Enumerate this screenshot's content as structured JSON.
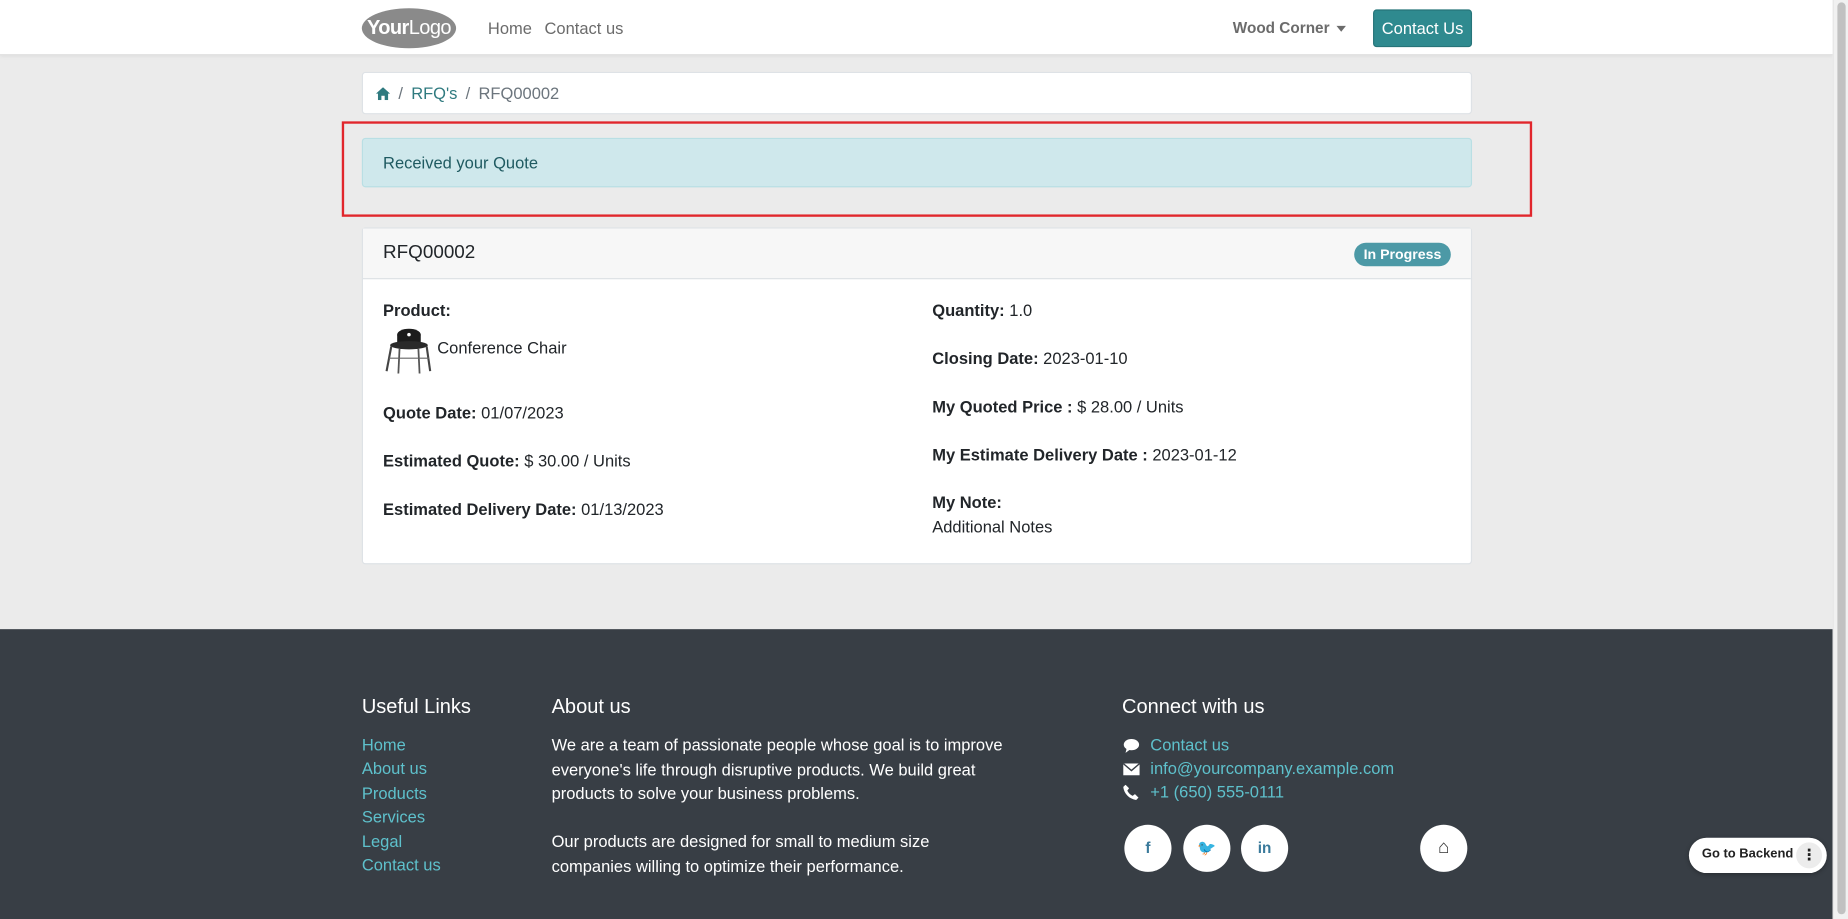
{
  "header": {
    "logo_bold": "Your",
    "logo_thin": "Logo",
    "nav": [
      "Home",
      "Contact us"
    ],
    "user_menu": "Wood Corner",
    "contact_button": "Contact Us"
  },
  "breadcrumb": {
    "home_icon": "home-icon",
    "items": [
      "RFQ's",
      "RFQ00002"
    ],
    "separator": "/"
  },
  "alert": {
    "text": "Received your Quote"
  },
  "rfq": {
    "title": "RFQ00002",
    "status": "In Progress",
    "product_label": "Product:",
    "product_name": "Conference Chair",
    "product_icon": "chair-icon",
    "quote_date_label": "Quote Date:",
    "quote_date": "01/07/2023",
    "estimated_quote_label": "Estimated Quote:",
    "estimated_quote": "$ 30.00",
    "estimated_quote_unit": "/ Units",
    "est_delivery_label": "Estimated Delivery Date:",
    "est_delivery": "01/13/2023",
    "quantity_label": "Quantity:",
    "quantity": "1.0",
    "closing_label": "Closing Date:",
    "closing": "2023-01-10",
    "my_price_label": "My Quoted Price :",
    "my_price": "$ 28.00",
    "my_price_unit": "/ Units",
    "my_delivery_label": "My Estimate Delivery Date :",
    "my_delivery": "2023-01-12",
    "note_label": "My Note:",
    "note": "Additional Notes"
  },
  "footer": {
    "useful_links_title": "Useful Links",
    "useful_links": [
      "Home",
      "About us",
      "Products",
      "Services",
      "Legal",
      "Contact us"
    ],
    "about_title": "About us",
    "about_p1_lines": [
      "We are a team of passionate people whose goal is to improve",
      "everyone's life through disruptive products. We build great",
      "products to solve your business problems."
    ],
    "about_p2_lines": [
      "Our products are designed for small to medium size",
      "companies willing to optimize their performance."
    ],
    "connect_title": "Connect with us",
    "connect_items": [
      {
        "icon": "comment-icon",
        "text": "Contact us"
      },
      {
        "icon": "envelope-icon",
        "text": "info@yourcompany.example.com"
      },
      {
        "icon": "phone-icon",
        "text": "+1 (650) 555-0111"
      }
    ],
    "social": [
      {
        "icon": "facebook-icon",
        "glyph": "f"
      },
      {
        "icon": "twitter-icon",
        "glyph": "🐦"
      },
      {
        "icon": "linkedin-icon",
        "glyph": "in"
      },
      {
        "icon": "home-icon",
        "glyph": "⌂"
      }
    ]
  },
  "backend": {
    "label": "Go to Backend",
    "menu_glyph": "⋮"
  },
  "colors": {
    "accent": "#2f8a8f",
    "badge": "#4c99a6",
    "footer_bg": "#383e45",
    "footer_link": "#5ec1cc",
    "alert_bg": "#cfe8ec",
    "highlight": "#e1262c"
  }
}
